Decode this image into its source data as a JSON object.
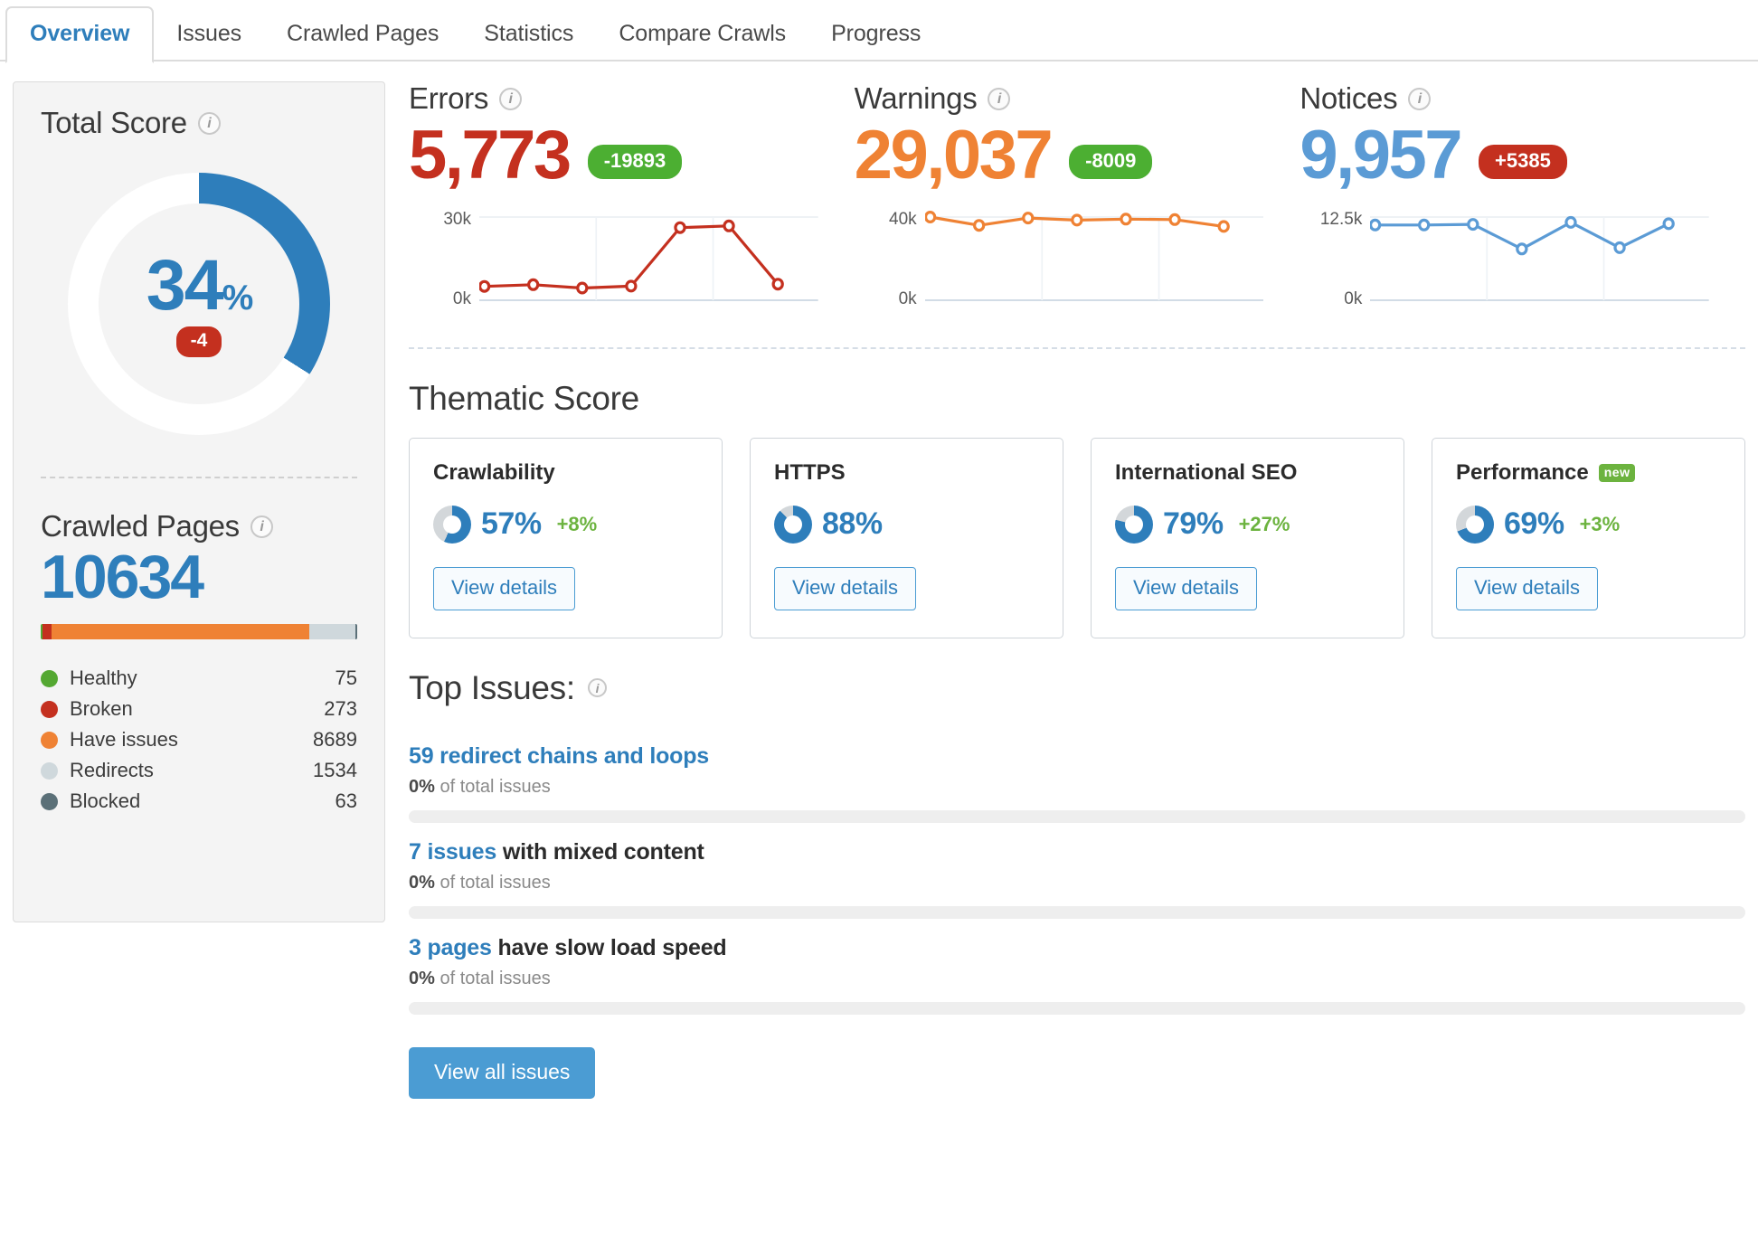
{
  "tabs": [
    {
      "label": "Overview",
      "active": true
    },
    {
      "label": "Issues",
      "active": false
    },
    {
      "label": "Crawled Pages",
      "active": false
    },
    {
      "label": "Statistics",
      "active": false
    },
    {
      "label": "Compare Crawls",
      "active": false
    },
    {
      "label": "Progress",
      "active": false
    }
  ],
  "colors": {
    "blue": "#2e7ebb",
    "light_blue": "#5b9bd5",
    "red": "#c4301f",
    "orange": "#ef8234",
    "green": "#4caf32",
    "gray": "#cfd8dc",
    "dark_gray": "#5b7078",
    "healthy_green": "#54a832"
  },
  "total_score": {
    "title": "Total Score",
    "info_icon": "info-icon",
    "value": "34",
    "unit": "%",
    "percent": 34,
    "delta": "-4",
    "delta_type": "negative"
  },
  "crawled_pages": {
    "title": "Crawled Pages",
    "info_icon": "info-icon",
    "total": "10634",
    "bar_segments": [
      {
        "name": "Healthy",
        "color": "#54a832",
        "percent": 0.7
      },
      {
        "name": "Broken",
        "color": "#c4301f",
        "percent": 2.6
      },
      {
        "name": "Have issues",
        "color": "#ef8234",
        "percent": 81.7
      },
      {
        "name": "Redirects",
        "color": "#cfd8dc",
        "percent": 14.4
      },
      {
        "name": "Blocked",
        "color": "#5b7078",
        "percent": 0.6
      }
    ],
    "legend": [
      {
        "label": "Healthy",
        "value": "75",
        "color": "#54a832"
      },
      {
        "label": "Broken",
        "value": "273",
        "color": "#c4301f"
      },
      {
        "label": "Have issues",
        "value": "8689",
        "color": "#ef8234"
      },
      {
        "label": "Redirects",
        "value": "1534",
        "color": "#cfd8dc"
      },
      {
        "label": "Blocked",
        "value": "63",
        "color": "#5b7078"
      }
    ]
  },
  "metrics": [
    {
      "title": "Errors",
      "value": "5,773",
      "delta": "-19893",
      "delta_type": "good",
      "color": "#c4301f",
      "axis_top": "30k",
      "axis_bottom": "0k"
    },
    {
      "title": "Warnings",
      "value": "29,037",
      "delta": "-8009",
      "delta_type": "good",
      "color": "#ef8234",
      "axis_top": "40k",
      "axis_bottom": "0k"
    },
    {
      "title": "Notices",
      "value": "9,957",
      "delta": "+5385",
      "delta_type": "bad",
      "color": "#5b9bd5",
      "axis_top": "12.5k",
      "axis_bottom": "0k"
    }
  ],
  "chart_data": [
    {
      "type": "line",
      "title": "Errors",
      "ylabel": "",
      "xlabel": "",
      "ylim": [
        0,
        30000
      ],
      "tick_labels_y": [
        "0k",
        "30k"
      ],
      "grid": true,
      "color": "#c4301f",
      "x": [
        1,
        2,
        3,
        4,
        5,
        6,
        7
      ],
      "values": [
        5000,
        5600,
        4400,
        5100,
        26200,
        26800,
        5800
      ]
    },
    {
      "type": "line",
      "title": "Warnings",
      "ylabel": "",
      "xlabel": "",
      "ylim": [
        0,
        40000
      ],
      "tick_labels_y": [
        "0k",
        "40k"
      ],
      "grid": true,
      "color": "#ef8234",
      "x": [
        1,
        2,
        3,
        4,
        5,
        6,
        7
      ],
      "values": [
        40000,
        36000,
        39500,
        38500,
        39000,
        38800,
        35500
      ]
    },
    {
      "type": "line",
      "title": "Notices",
      "ylabel": "",
      "xlabel": "",
      "ylim": [
        0,
        12500
      ],
      "tick_labels_y": [
        "0k",
        "12.5k"
      ],
      "grid": true,
      "color": "#5b9bd5",
      "x": [
        1,
        2,
        3,
        4,
        5,
        6,
        7
      ],
      "values": [
        11300,
        11300,
        11400,
        7700,
        11700,
        7900,
        11500
      ]
    }
  ],
  "thematic": {
    "title": "Thematic Score",
    "cards": [
      {
        "name": "Crawlability",
        "percent": "57%",
        "value": 57,
        "delta": "+8%",
        "badge": null,
        "button": "View details"
      },
      {
        "name": "HTTPS",
        "percent": "88%",
        "value": 88,
        "delta": "",
        "badge": null,
        "button": "View details"
      },
      {
        "name": "International SEO",
        "percent": "79%",
        "value": 79,
        "delta": "+27%",
        "badge": null,
        "button": "View details"
      },
      {
        "name": "Performance",
        "percent": "69%",
        "value": 69,
        "delta": "+3%",
        "badge": "new",
        "button": "View details"
      }
    ]
  },
  "top_issues": {
    "title": "Top Issues:",
    "info_icon": "info-icon",
    "items": [
      {
        "link_text": "59 redirect chains and loops",
        "rest_text": "",
        "sub_bold": "0%",
        "sub_rest": " of total issues",
        "bar_percent": 0
      },
      {
        "link_text": "7 issues",
        "rest_text": " with mixed content",
        "sub_bold": "0%",
        "sub_rest": " of total issues",
        "bar_percent": 0
      },
      {
        "link_text": "3 pages",
        "rest_text": " have slow load speed",
        "sub_bold": "0%",
        "sub_rest": " of total issues",
        "bar_percent": 0
      }
    ],
    "view_all_button": "View all issues"
  }
}
